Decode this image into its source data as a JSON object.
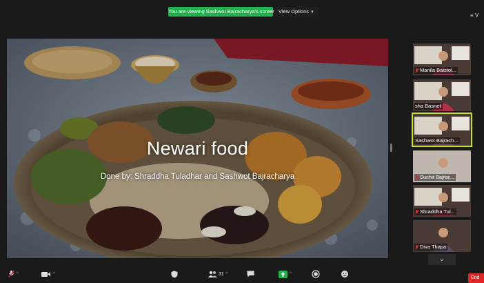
{
  "top": {
    "share_banner": "You are viewing Sashwot Bajracharya's screen",
    "view_options": "View Options",
    "view_toggle": "≡ V"
  },
  "slide": {
    "title": "Newari food",
    "subtitle": "Done by: Shraddha Tuladhar and Sashwot Bajracharya"
  },
  "participants": [
    {
      "name": "Manila Baistol...",
      "muted": true,
      "active": false,
      "accent": "#8a3a52"
    },
    {
      "name": "sha Basnet",
      "muted": false,
      "active": false,
      "accent": "#b0324a"
    },
    {
      "name": "Sashwot Bajrach...",
      "muted": false,
      "active": true,
      "accent": "#6b4a3a"
    },
    {
      "name": "Suchit Bajrac...",
      "muted": true,
      "active": false,
      "accent": "#c9c2b8"
    },
    {
      "name": "Shraddha Tul...",
      "muted": true,
      "active": false,
      "accent": "#7a2e3c"
    },
    {
      "name": "Diva Thapa",
      "muted": true,
      "active": false,
      "accent": "#5a4a5a"
    }
  ],
  "toolbar": {
    "participants_count": "31",
    "end_label": "End"
  },
  "colors": {
    "share_green": "#22b14c",
    "active_outline": "#c6e21b",
    "end_red": "#e02828",
    "share_arrow_green": "#22b14c"
  }
}
